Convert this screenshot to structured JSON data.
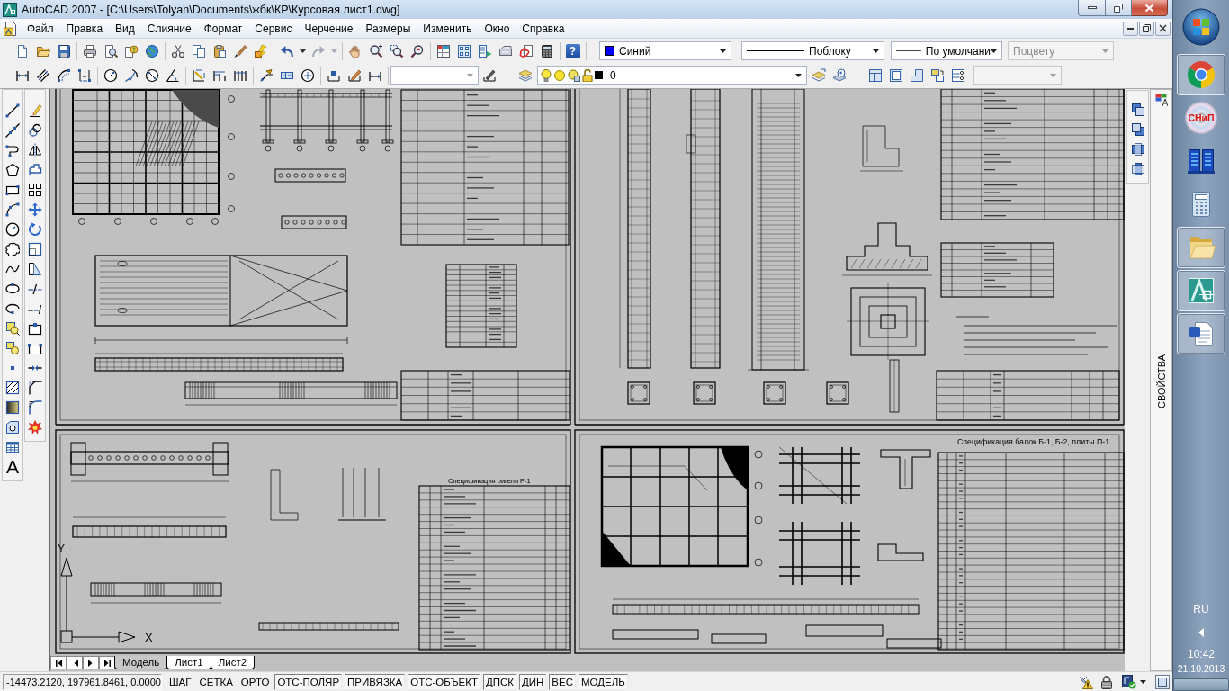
{
  "window": {
    "title": "AutoCAD 2007 - [C:\\Users\\Tolyan\\Documents\\жбк\\КР\\Курсовая лист1.dwg]"
  },
  "menu": [
    "Файл",
    "Правка",
    "Вид",
    "Слияние",
    "Формат",
    "Сервис",
    "Черчение",
    "Размеры",
    "Изменить",
    "Окно",
    "Справка"
  ],
  "standard_toolbar": {
    "help_glyph": "?"
  },
  "properties_toolbar": {
    "color": {
      "value": "Синий",
      "color": "#0000ff"
    },
    "linetype": {
      "value": "Поблоку"
    },
    "lineweight": {
      "value": "По умолчани"
    },
    "plot_style": {
      "value": "Поцвету",
      "disabled": true
    }
  },
  "layers_toolbar": {
    "layer": {
      "name": "0",
      "on": true,
      "frozen": false,
      "locked": false,
      "color": "#000000"
    }
  },
  "draw_toolbar": {
    "text_glyph": "A"
  },
  "drawing": {
    "headings": [
      "Спецификация ригеля Р-1",
      "Спецификация балок Б-1, Б-2, плиты П-1"
    ],
    "ucs_icon": {
      "x_label": "X",
      "y_label": "Y"
    }
  },
  "layout_tabs": [
    {
      "label": "Модель",
      "selected": true
    },
    {
      "label": "Лист1",
      "selected": false
    },
    {
      "label": "Лист2",
      "selected": false
    }
  ],
  "palette": {
    "title": "СВОЙСТВА"
  },
  "status_bar": {
    "coordinates": "-14473.2120, 197961.8461, 0.0000",
    "toggles": [
      {
        "label": "ШАГ",
        "on": false
      },
      {
        "label": "СЕТКА",
        "on": false
      },
      {
        "label": "ОРТО",
        "on": false
      },
      {
        "label": "ОТС-ПОЛЯР",
        "on": true
      },
      {
        "label": "ПРИВЯЗКА",
        "on": true
      },
      {
        "label": "ОТС-ОБЪЕКТ",
        "on": true
      },
      {
        "label": "ДПСК",
        "on": true
      },
      {
        "label": "ДИН",
        "on": true
      },
      {
        "label": "ВЕС",
        "on": true
      },
      {
        "label": "МОДЕЛЬ",
        "on": true
      }
    ]
  },
  "taskbar": {
    "items": [
      {
        "kind": "browser",
        "running": true
      },
      {
        "kind": "disc",
        "label": "СНиП",
        "running": false
      },
      {
        "kind": "rack",
        "running": false
      },
      {
        "kind": "calculator",
        "running": false
      },
      {
        "kind": "folder",
        "running": true
      },
      {
        "kind": "cad",
        "running": true
      },
      {
        "kind": "document",
        "running": true
      }
    ],
    "language": "RU",
    "time": "10:42",
    "date": "21.10.2013"
  }
}
